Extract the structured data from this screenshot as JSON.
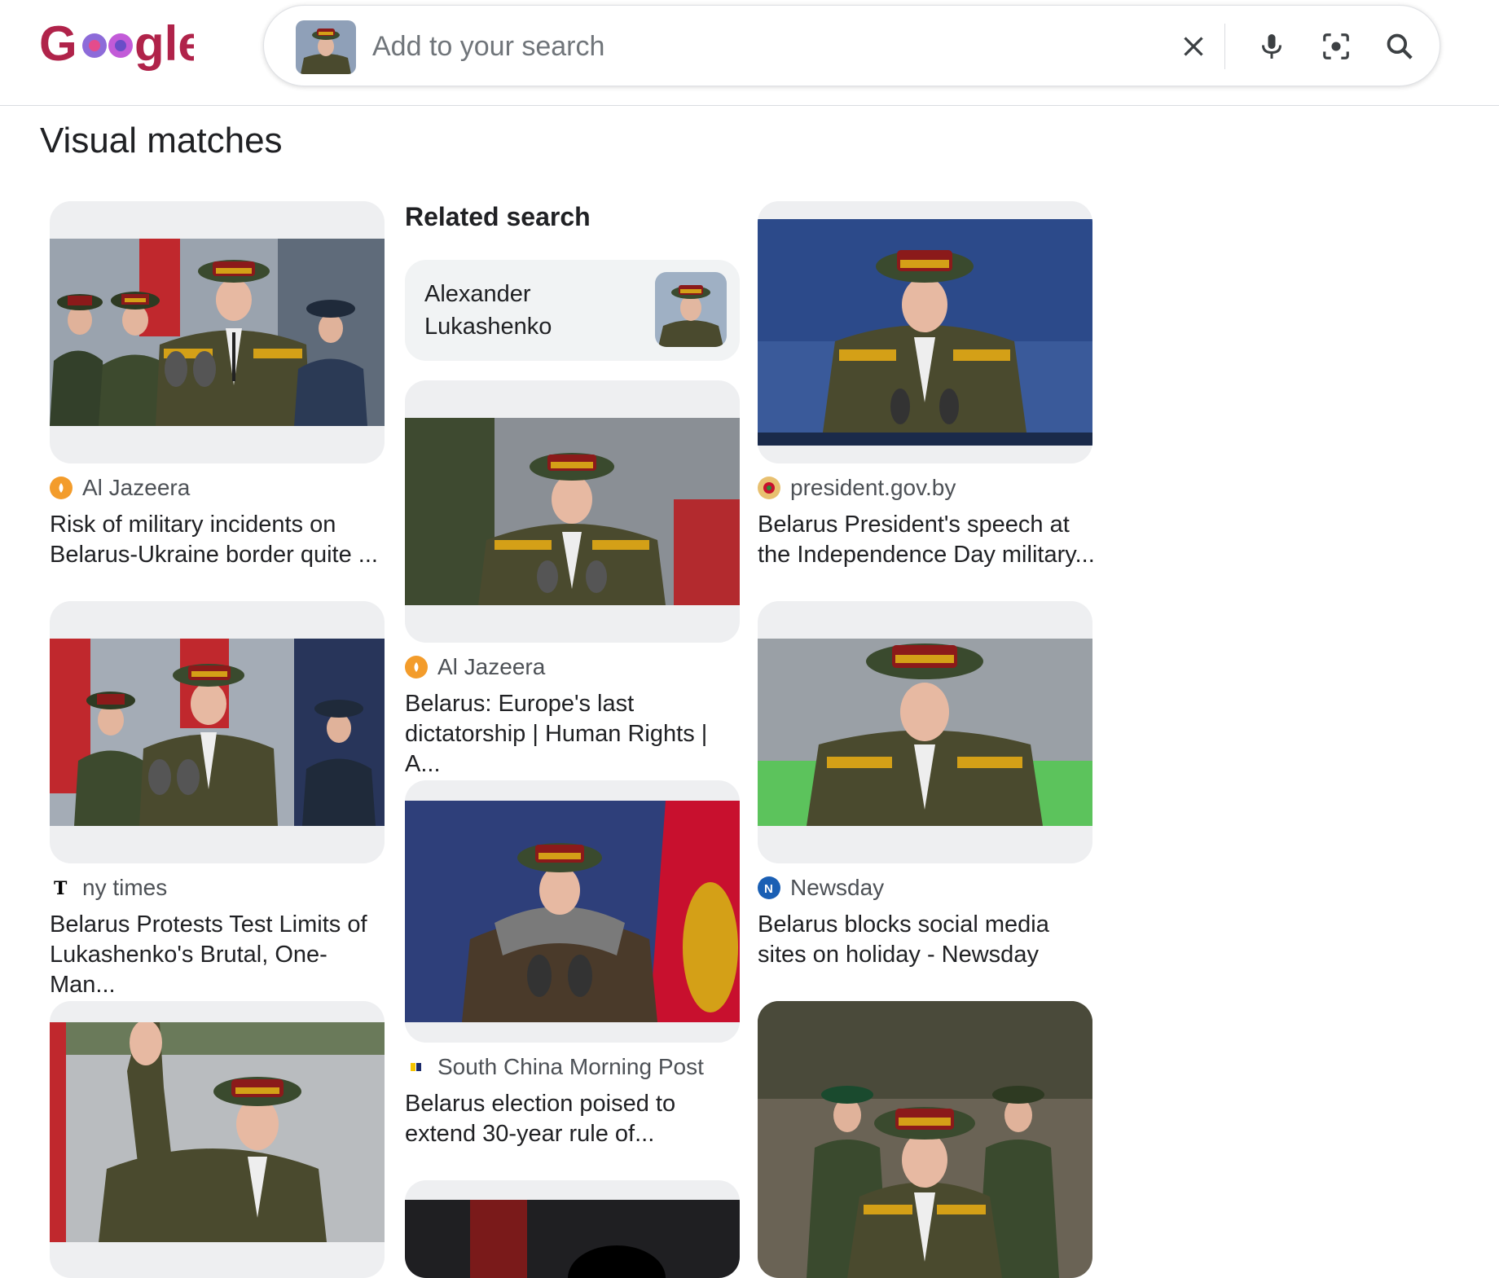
{
  "header": {
    "logo_text": "Google",
    "search": {
      "placeholder": "Add to your search",
      "value": ""
    }
  },
  "icons": {
    "clear": "close-icon",
    "voice": "microphone-icon",
    "lens": "camera-lens-icon",
    "search": "search-icon"
  },
  "section_title": "Visual matches",
  "related": {
    "heading": "Related search",
    "chip_label": "Alexander Lukashenko"
  },
  "results": [
    {
      "source": "Al Jazeera",
      "title": "Risk of military incidents on Belarus-Ukraine border quite ...",
      "favicon_color": "#f39c2b"
    },
    {
      "source": "president.gov.by",
      "title": "Belarus President's speech at the Independence Day military...",
      "favicon_color": "#c8102e"
    },
    {
      "source": "Al Jazeera",
      "title": "Belarus: Europe's last dictatorship | Human Rights | A...",
      "favicon_color": "#f39c2b"
    },
    {
      "source": "ny times",
      "title": "Belarus Protests Test Limits of Lukashenko's Brutal, One-Man...",
      "favicon_color": "#000000"
    },
    {
      "source": "Newsday",
      "title": "Belarus blocks social media sites on holiday - Newsday",
      "favicon_color": "#1a5fb4"
    },
    {
      "source": "South China Morning Post",
      "title": "Belarus election poised to extend 30-year rule of...",
      "favicon_color": "#f5c400"
    }
  ],
  "colors": {
    "card_bg": "#eeeff1",
    "uniform": "#4a4a2e",
    "cap": "#8b1a1a",
    "gold": "#d4a017"
  }
}
